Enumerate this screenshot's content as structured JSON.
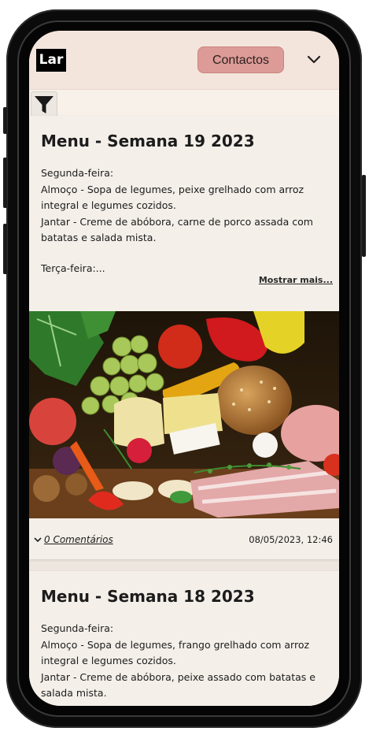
{
  "header": {
    "logo_text": "Lar",
    "contact_label": "Contactos",
    "menu_toggle_icon": "chevron-down-icon"
  },
  "filter": {
    "icon": "filter-icon"
  },
  "posts": [
    {
      "title": "Menu - Semana 19 2023",
      "day": "Segunda-feira:",
      "lunch": "Almoço - Sopa de legumes, peixe grelhado com arroz integral e legumes cozidos.",
      "dinner": "Jantar - Creme de abóbora, carne de porco assada com batatas e salada mista.",
      "next_day": "Terça-feira:...",
      "more_label": "Mostrar mais...",
      "comments_label": "0 Comentários",
      "timestamp": "08/05/2023, 12:46"
    },
    {
      "title": "Menu - Semana 18 2023",
      "day": "Segunda-feira:",
      "lunch": "Almoço - Sopa de legumes, frango grelhado com arroz integral e legumes cozidos.",
      "dinner": "Jantar - Creme de abóbora, peixe assado com batatas e salada mista."
    }
  ],
  "colors": {
    "header_bg": "#f4e5dc",
    "contact_button": "#dc9b96",
    "page_bg": "#ede6df"
  }
}
